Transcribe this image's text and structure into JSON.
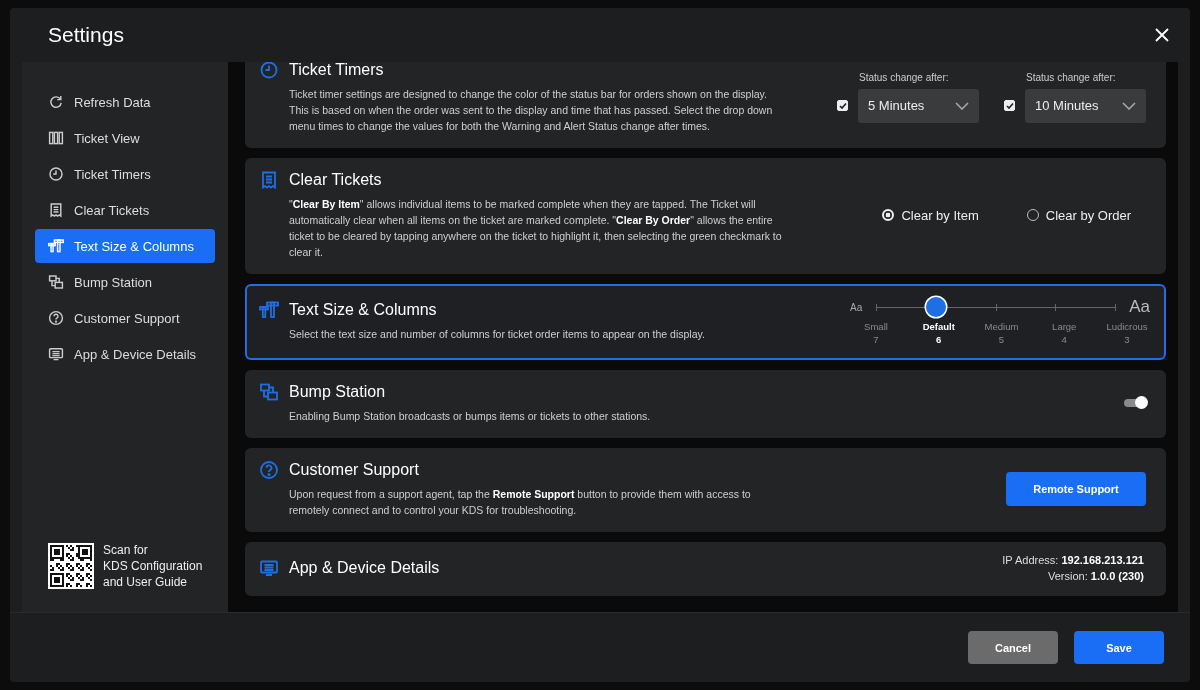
{
  "window": {
    "title": "Settings"
  },
  "sidebar": {
    "items": [
      {
        "label": "Refresh Data",
        "selected": false
      },
      {
        "label": "Ticket View",
        "selected": false
      },
      {
        "label": "Ticket Timers",
        "selected": false
      },
      {
        "label": "Clear Tickets",
        "selected": false
      },
      {
        "label": "Text Size & Columns",
        "selected": true
      },
      {
        "label": "Bump Station",
        "selected": false
      },
      {
        "label": "Customer Support",
        "selected": false
      },
      {
        "label": "App & Device Details",
        "selected": false
      }
    ],
    "qr_caption": "Scan for\nKDS Configuration\nand User Guide"
  },
  "cards": [
    {
      "kind": "timers",
      "focused": false,
      "title": "Ticket Timers",
      "description": "Ticket timer settings are designed to change the color of the status bar for orders shown on the display. This is based on when the order was sent to the display and time that has passed. Select the drop down menu times to change the values for both the Warning and Alert Status change after times.",
      "timers": [
        {
          "label": "Status change after:",
          "checked": true,
          "value": "5 Minutes"
        },
        {
          "label": "Status change after:",
          "checked": true,
          "value": "10 Minutes"
        }
      ]
    },
    {
      "kind": "radio",
      "focused": false,
      "title": "Clear Tickets",
      "description": "\"**Clear By Item**\" allows individual items to be marked complete when they are tapped. The Ticket will automatically clear when all items on the ticket are marked complete. \"**Clear By Order**\" allows the entire ticket to be cleared by tapping anywhere on the ticket to highlight it, then selecting the green checkmark to clear it.",
      "options": [
        {
          "label": "Clear by Item",
          "selected": true
        },
        {
          "label": "Clear by Order",
          "selected": false
        }
      ]
    },
    {
      "kind": "slider",
      "focused": true,
      "title": "Text Size & Columns",
      "description": "Select the text size and number of columns for ticket order items to appear on the display.",
      "small_label": "Aa",
      "large_label": "Aa",
      "level": 0.25,
      "stops": [
        {
          "label": "Small",
          "columns": "7",
          "selected": false
        },
        {
          "label": "Default",
          "columns": "6",
          "selected": true
        },
        {
          "label": "Medium",
          "columns": "5",
          "selected": false
        },
        {
          "label": "Large",
          "columns": "4",
          "selected": false
        },
        {
          "label": "Ludicrous",
          "columns": "3",
          "selected": false
        }
      ]
    },
    {
      "kind": "toggle",
      "focused": false,
      "title": "Bump Station",
      "description": "Enabling Bump Station broadcasts or bumps items or tickets to other stations.",
      "on": true
    },
    {
      "kind": "button",
      "focused": false,
      "title": "Customer Support",
      "description": "Upon request from a support agent, tap the **Remote Support** button to provide them with access to remotely connect and to control your KDS for troubleshooting.",
      "button": "Remote Support"
    },
    {
      "kind": "info",
      "focused": false,
      "title": "App & Device Details",
      "details": [
        "IP Address: **192.168.213.121**",
        "Version: **1.0.0 (230)**"
      ]
    }
  ],
  "footer": {
    "buttons": [
      {
        "label": "Cancel",
        "kind": "secondary"
      },
      {
        "label": "Save",
        "kind": "primary"
      }
    ]
  }
}
